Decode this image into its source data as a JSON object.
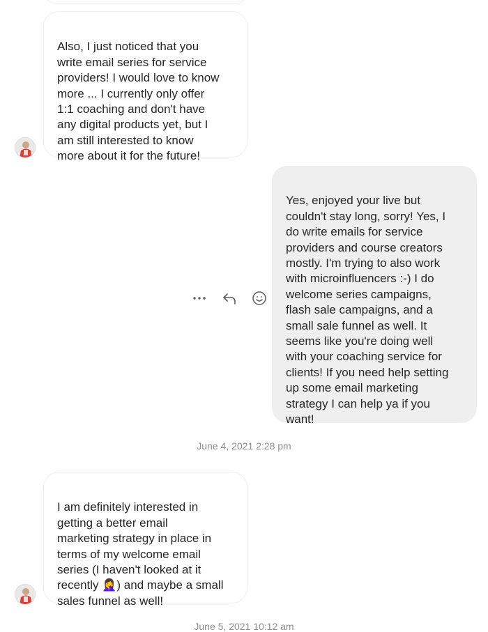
{
  "messages": [
    {
      "text": "Also, I just noticed that you\nwrite email series for service\nproviders! I would love to know\nmore ... I currently only offer\n1:1 coaching and don't have\nany digital products yet, but I\nam still interested to know\nmore about it for the future!"
    },
    {
      "text": "Yes, enjoyed your live but\ncouldn't stay long, sorry! Yes, I\ndo write emails for service\nproviders and course creators\nmostly. I'm trying to also work\nwith microinfluencers :-) I do\nwelcome series campaigns,\nflash sale campaigns, and a\nsmall sale funnel as well. It\nseems like you're doing well\nwith your coaching service for\nclients! If you need help setting\nup some email marketing\nstrategy I can help ya if you\nwant!"
    },
    {
      "text": "I am definitely interested in\ngetting a better email\nmarketing strategy in place in\nterms of my welcome email\nseries (I haven't looked at it\nrecently 🤦‍♀️) and maybe a small\nsales funnel as well!"
    }
  ],
  "timestamps": [
    "June 4, 2021 2:28 pm",
    "June 5, 2021 10:12 am"
  ],
  "actions": {
    "more": "more-options-icon",
    "reply": "reply-icon",
    "react": "emoji-react-icon"
  },
  "colors": {
    "sent_bubble": "#efefef",
    "received_border": "#efefef",
    "text": "#262626",
    "timestamp": "#8e8e8e",
    "avatar_accent": "#d8403a"
  }
}
